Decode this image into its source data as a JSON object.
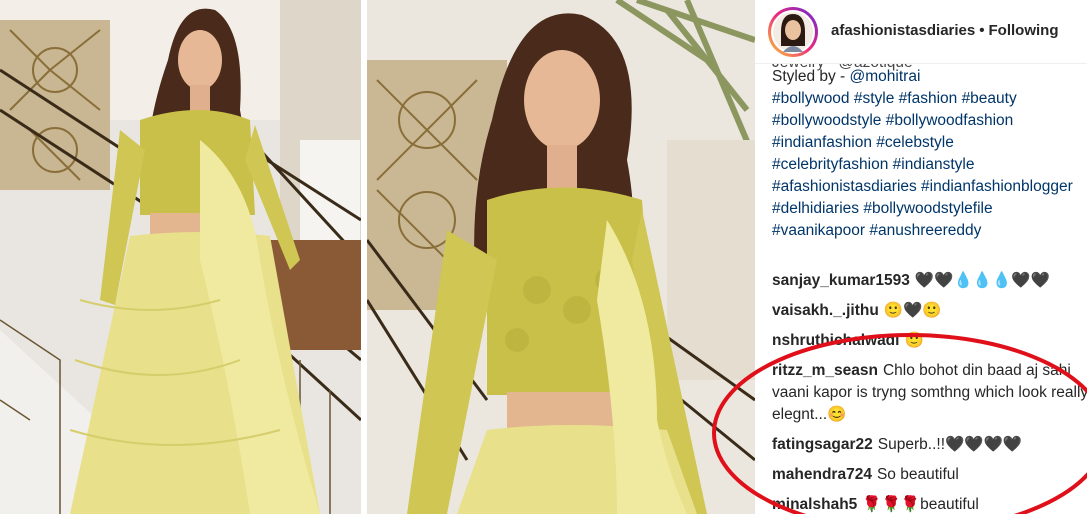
{
  "post": {
    "username": "afashionistasdiaries",
    "separator": "•",
    "follow_status": "Following",
    "caption_cut_line": "Jewelry - @azotique",
    "styled_prefix": "Styled by - ",
    "styled_handle": "@mohitrai",
    "hashtag_lines": [
      "#bollywood #style #fashion #beauty",
      "#bollywoodstyle #bollywoodfashion",
      "#indianfashion #celebstyle",
      "#celebrityfashion #indianstyle",
      "#afashionistasdiaries #indianfashionblogger",
      "#delhidiaries #bollywoodstylefile",
      "#vaanikapoor #anushreereddy"
    ]
  },
  "comments": [
    {
      "user": "sanjay_kumar1593",
      "text": "🖤🖤💧💧💧🖤🖤"
    },
    {
      "user": "vaisakh._.jithu",
      "text": "🙂🖤🙂"
    },
    {
      "user": "nshruthichalwadi",
      "text": "🙂"
    },
    {
      "user": "ritzz_m_seasn",
      "text": "Chlo bohot din baad aj sahi vaani kapor is tryng somthng which look really elegnt...😊"
    },
    {
      "user": "fatingsagar22",
      "text": "Superb..!!🖤🖤🖤🖤"
    },
    {
      "user": "mahendra724",
      "text": "So beautiful"
    },
    {
      "user": "minalshah5",
      "text": "🌹🌹🌹beautiful"
    }
  ],
  "colors": {
    "link": "#003569",
    "annotation": "#e0101a",
    "dress": "#e8e08a"
  },
  "icons": {
    "avatar": "profile-avatar",
    "annotation": "red-ellipse-annotation"
  }
}
